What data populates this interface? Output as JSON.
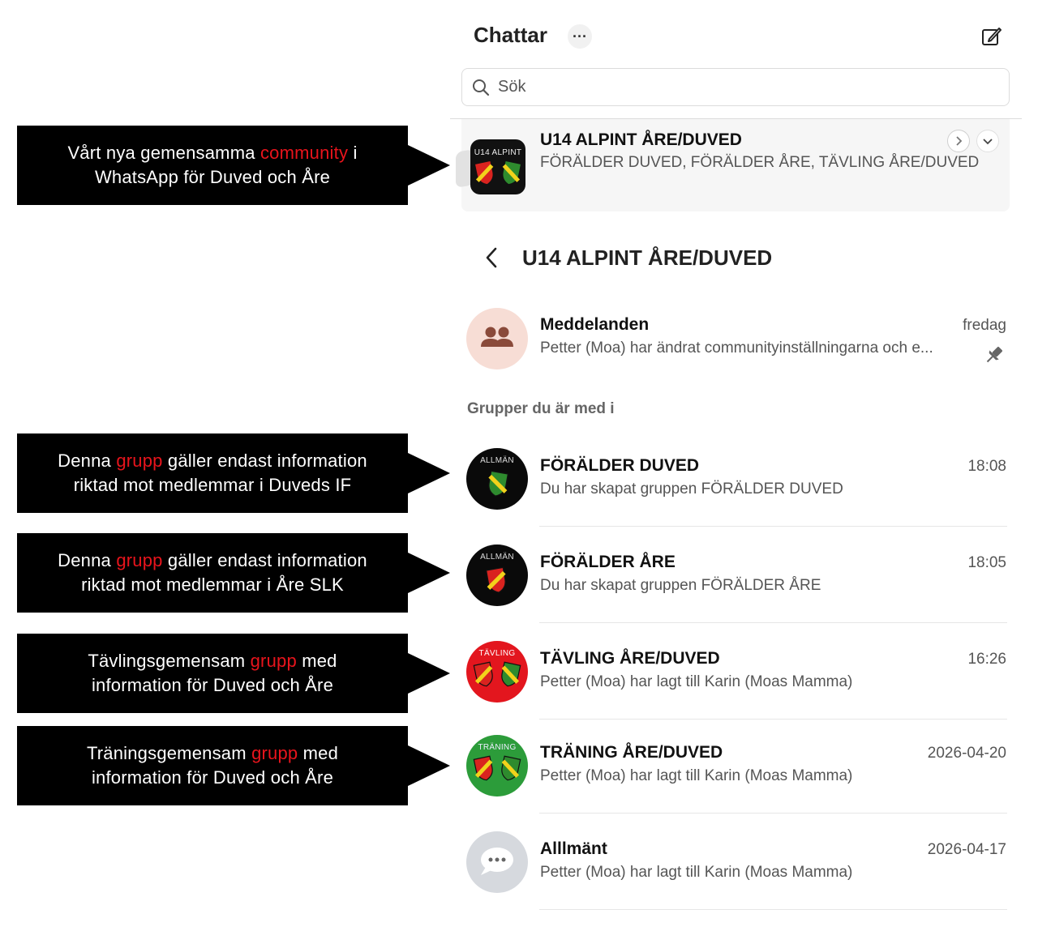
{
  "header": {
    "title": "Chattar",
    "more_glyph": "···",
    "search_placeholder": "Sök"
  },
  "community": {
    "name": "U14 ALPINT ÅRE/DUVED",
    "subtitle": "FÖRÄLDER DUVED, FÖRÄLDER ÅRE, TÄVLING ÅRE/DUVED",
    "avatar_label": "U14 ALPINT"
  },
  "community_view": {
    "title": "U14 ALPINT ÅRE/DUVED"
  },
  "announcements": {
    "name": "Meddelanden",
    "time": "fredag",
    "message": "Petter (Moa) har ändrat communityinställningarna och e...",
    "avatar_bg": "#f7ddd5"
  },
  "section_label": "Grupper du är med i",
  "groups": [
    {
      "name": "FÖRÄLDER DUVED",
      "time": "18:08",
      "message": "Du har skapat gruppen FÖRÄLDER DUVED",
      "avatar_label": "ALLMÄN",
      "avatar_bg": "#0a0a0a"
    },
    {
      "name": "FÖRÄLDER ÅRE",
      "time": "18:05",
      "message": "Du har skapat gruppen FÖRÄLDER ÅRE",
      "avatar_label": "ALLMÄN",
      "avatar_bg": "#0a0a0a"
    },
    {
      "name": "TÄVLING ÅRE/DUVED",
      "time": "16:26",
      "message": "Petter (Moa) har lagt till Karin (Moas Mamma)",
      "avatar_label": "TÄVLING",
      "avatar_bg": "#e3161e"
    },
    {
      "name": "TRÄNING ÅRE/DUVED",
      "time": "2026-04-20",
      "message": "Petter (Moa) har lagt till Karin (Moas Mamma)",
      "avatar_label": "TRÄNING",
      "avatar_bg": "#2c9c3a"
    },
    {
      "name": "Alllmänt",
      "time": "2026-04-17",
      "message": "Petter (Moa) har lagt till Karin (Moas Mamma)",
      "avatar_bg": "#d6d9de"
    }
  ],
  "callouts": [
    {
      "line1_a": "Vårt nya gemensamma ",
      "line1_hl": "community",
      "line1_b": " i",
      "line2": "WhatsApp för Duved och Åre"
    },
    {
      "line1_a": "Denna ",
      "line1_hl": "grupp",
      "line1_b": " gäller endast information",
      "line2": "riktad mot medlemmar i Duveds IF"
    },
    {
      "line1_a": "Denna ",
      "line1_hl": "grupp",
      "line1_b": " gäller endast information",
      "line2": "riktad mot medlemmar i Åre SLK"
    },
    {
      "line1_a": "Tävlingsgemensam ",
      "line1_hl": "grupp",
      "line1_b": " med",
      "line2": "information för Duved och Åre"
    },
    {
      "line1_a": "Träningsgemensam ",
      "line1_hl": "grupp",
      "line1_b": " med",
      "line2": "information för Duved och Åre"
    }
  ],
  "colors": {
    "highlight": "#e8141c",
    "callout_bg": "#000000",
    "are_shield": "#d9231f",
    "duved_shield": "#2e8b2e",
    "shield_accent": "#f2d21b"
  }
}
